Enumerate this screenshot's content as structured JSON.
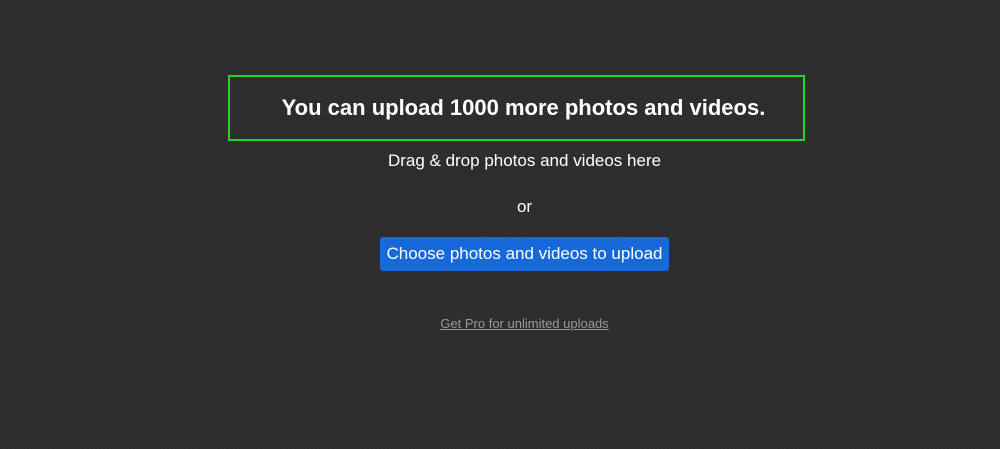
{
  "upload": {
    "quota_message": "You can upload 1000 more photos and videos.",
    "drag_text": "Drag & drop photos and videos here",
    "or_text": "or",
    "button_label": "Choose photos and videos to upload",
    "pro_link": "Get Pro for unlimited uploads"
  },
  "colors": {
    "background": "#2d2d2d",
    "highlight_border": "#22d622",
    "button": "#1769d9",
    "link": "#9a9a9a"
  }
}
